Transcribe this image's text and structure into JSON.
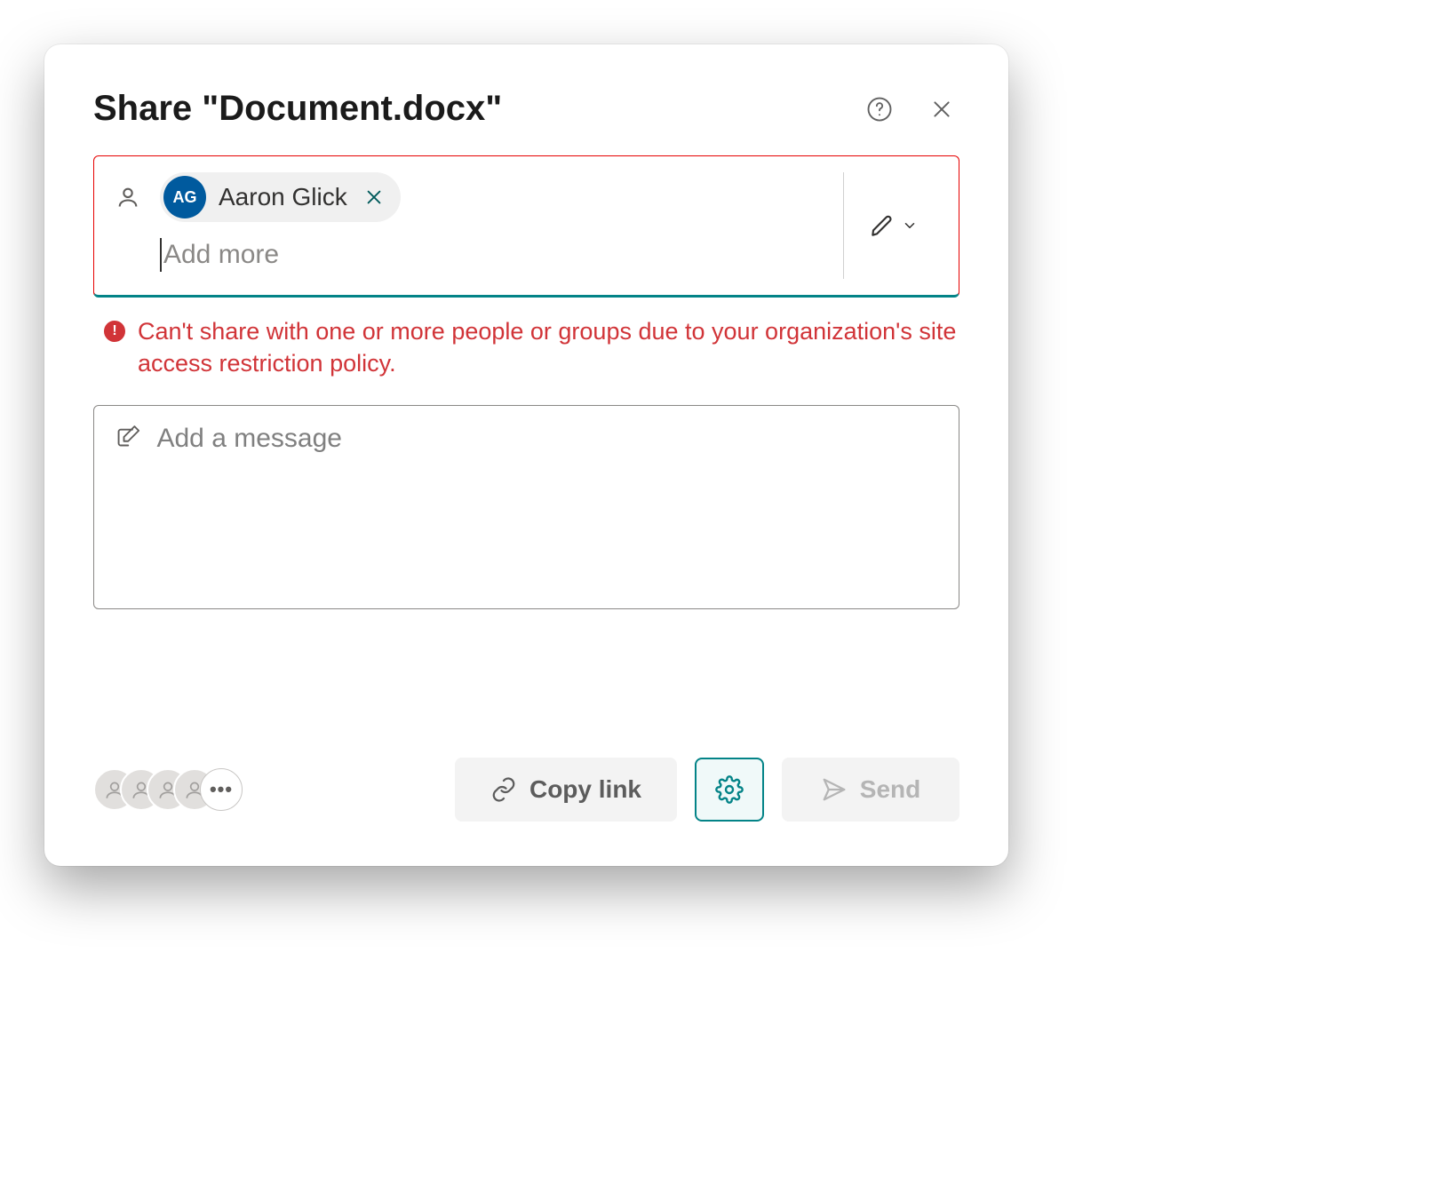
{
  "dialog": {
    "title": "Share \"Document.docx\""
  },
  "recipients": {
    "chip": {
      "initials": "AG",
      "name": "Aaron Glick"
    },
    "placeholder": "Add more"
  },
  "error": {
    "message": "Can't share with one or more people or groups due to your organization's site access restriction policy."
  },
  "message": {
    "placeholder": "Add a message"
  },
  "facepile": {
    "overflow": "•••"
  },
  "footer": {
    "copy_label": "Copy link",
    "send_label": "Send"
  }
}
